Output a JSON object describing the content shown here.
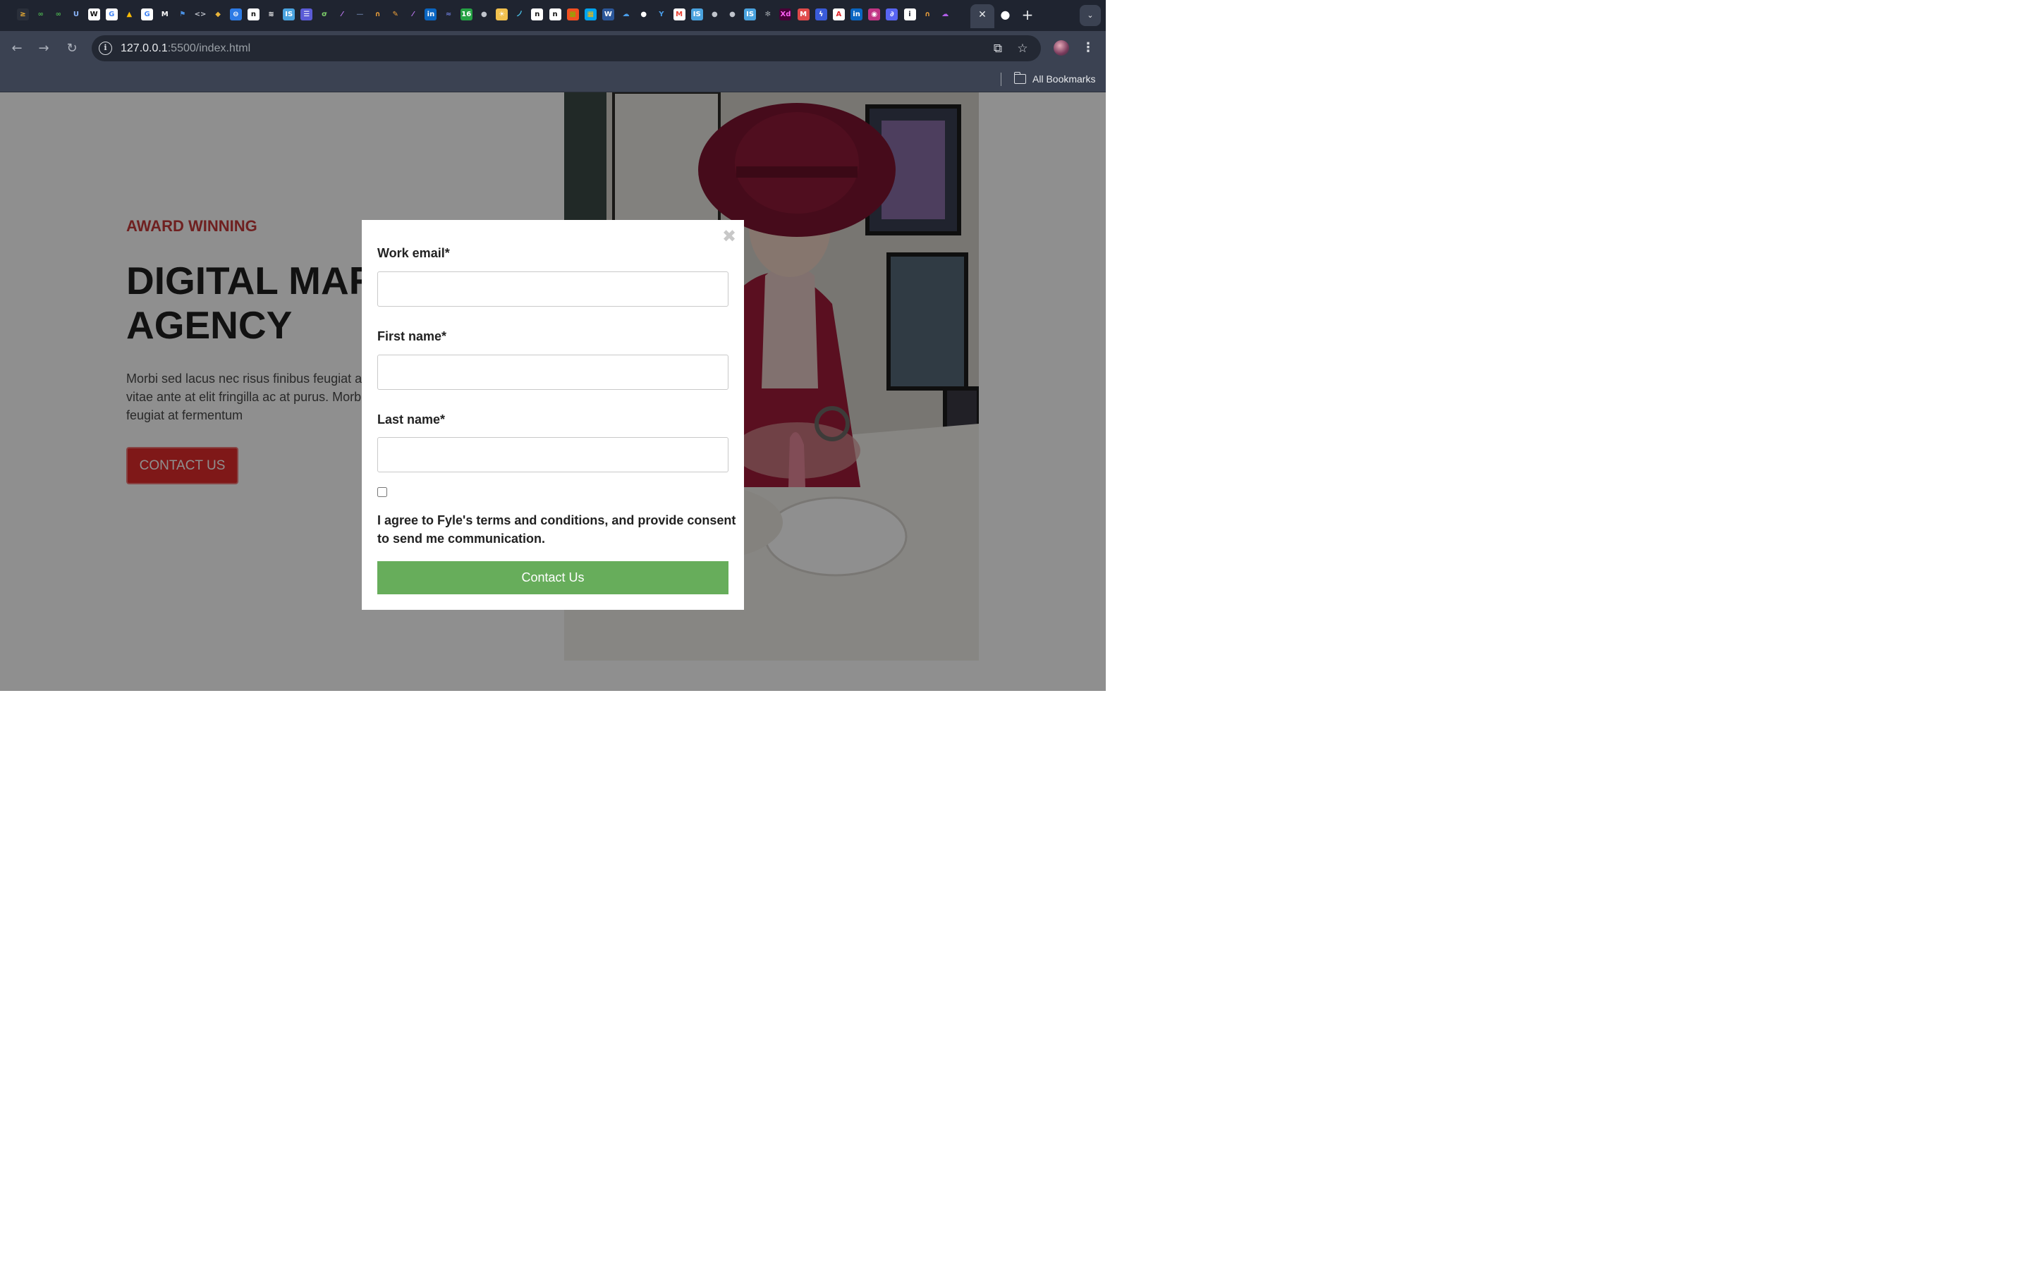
{
  "browser": {
    "tabs": {
      "favicons": [
        {
          "name": "stripe-favicon",
          "glyph": "≥",
          "bg": "#2a2f3a",
          "color": "#f2b233"
        },
        {
          "name": "link-favicon",
          "glyph": "∞",
          "bg": "#1f2430",
          "color": "#4caf50"
        },
        {
          "name": "link-favicon",
          "glyph": "∞",
          "bg": "#1f2430",
          "color": "#4caf50"
        },
        {
          "name": "bucket-favicon",
          "glyph": "U",
          "bg": "#1f2430",
          "color": "#8ab4f8"
        },
        {
          "name": "webflow-favicon",
          "glyph": "W",
          "bg": "#ffffff",
          "color": "#111111"
        },
        {
          "name": "google-favicon",
          "glyph": "G",
          "bg": "#ffffff",
          "color": "#4285f4"
        },
        {
          "name": "drive-favicon",
          "glyph": "▲",
          "bg": "#1f2430",
          "color": "#fbbc04"
        },
        {
          "name": "google-favicon",
          "glyph": "G",
          "bg": "#ffffff",
          "color": "#4285f4"
        },
        {
          "name": "medium-favicon",
          "glyph": "M",
          "bg": "#1f2430",
          "color": "#ffffff"
        },
        {
          "name": "flag-favicon",
          "glyph": "⚑",
          "bg": "#1f2430",
          "color": "#4a90e2"
        },
        {
          "name": "code-favicon",
          "glyph": "<>",
          "bg": "#1f2430",
          "color": "#c0c4cc"
        },
        {
          "name": "shield-favicon",
          "glyph": "◆",
          "bg": "#1f2430",
          "color": "#e8b43a"
        },
        {
          "name": "globe-favicon",
          "glyph": "⊖",
          "bg": "#2d7be5",
          "color": "#ffffff"
        },
        {
          "name": "notion-favicon",
          "glyph": "n",
          "bg": "#ffffff",
          "color": "#111111"
        },
        {
          "name": "stats-favicon",
          "glyph": "≋",
          "bg": "#1f2430",
          "color": "#ffffff"
        },
        {
          "name": "is-favicon",
          "glyph": "IS",
          "bg": "#4aa3df",
          "color": "#ffffff"
        },
        {
          "name": "list-favicon",
          "glyph": "☰",
          "bg": "#5b5bd6",
          "color": "#ffffff"
        },
        {
          "name": "leaf-favicon",
          "glyph": "σ",
          "bg": "#1f2430",
          "color": "#7fd36b"
        },
        {
          "name": "feather-favicon",
          "glyph": "⁄",
          "bg": "#1f2430",
          "color": "#c77dff"
        },
        {
          "name": "dash-favicon",
          "glyph": "—",
          "bg": "#1f2430",
          "color": "#5a6b8c"
        },
        {
          "name": "headset-favicon",
          "glyph": "∩",
          "bg": "#1f2430",
          "color": "#f2a33a"
        },
        {
          "name": "edit-favicon",
          "glyph": "✎",
          "bg": "#1f2430",
          "color": "#f2a33a"
        },
        {
          "name": "feather-favicon",
          "glyph": "⁄",
          "bg": "#1f2430",
          "color": "#c77dff"
        },
        {
          "name": "linkedin-favicon",
          "glyph": "in",
          "bg": "#0a66c2",
          "color": "#ffffff"
        },
        {
          "name": "wave-favicon",
          "glyph": "≈",
          "bg": "#1f2430",
          "color": "#6b7bd6"
        },
        {
          "name": "badge-favicon",
          "glyph": "16",
          "bg": "#25a244",
          "color": "#ffffff"
        },
        {
          "name": "globe-favicon",
          "glyph": "●",
          "bg": "#1f2430",
          "color": "#c0c4cc"
        },
        {
          "name": "sun-favicon",
          "glyph": "☀",
          "bg": "#f2c14e",
          "color": "#ffffff"
        },
        {
          "name": "pen-favicon",
          "glyph": "ノ",
          "bg": "#1f2430",
          "color": "#4ac1e8"
        },
        {
          "name": "notion-favicon",
          "glyph": "n",
          "bg": "#ffffff",
          "color": "#111111"
        },
        {
          "name": "notion-favicon",
          "glyph": "n",
          "bg": "#ffffff",
          "color": "#111111"
        },
        {
          "name": "microsoft-favicon",
          "glyph": "▦",
          "bg": "#f25022",
          "color": "#7fba00"
        },
        {
          "name": "microsoft-favicon",
          "glyph": "▦",
          "bg": "#00a4ef",
          "color": "#ffb900"
        },
        {
          "name": "word-favicon",
          "glyph": "W",
          "bg": "#2b579a",
          "color": "#ffffff"
        },
        {
          "name": "onedrive-favicon",
          "glyph": "☁",
          "bg": "#1f2430",
          "color": "#4a9de8"
        },
        {
          "name": "github-favicon",
          "glyph": "●",
          "bg": "#1f2430",
          "color": "#ffffff"
        },
        {
          "name": "bird-favicon",
          "glyph": "Y",
          "bg": "#1f2430",
          "color": "#4a9de8"
        },
        {
          "name": "gmail-favicon",
          "glyph": "M",
          "bg": "#ffffff",
          "color": "#ea4335"
        },
        {
          "name": "is-favicon",
          "glyph": "IS",
          "bg": "#4aa3df",
          "color": "#ffffff"
        },
        {
          "name": "globe-favicon",
          "glyph": "●",
          "bg": "#1f2430",
          "color": "#c0c4cc"
        },
        {
          "name": "globe-favicon",
          "glyph": "●",
          "bg": "#1f2430",
          "color": "#c0c4cc"
        },
        {
          "name": "is-favicon",
          "glyph": "IS",
          "bg": "#4aa3df",
          "color": "#ffffff"
        },
        {
          "name": "react-favicon",
          "glyph": "✻",
          "bg": "#1f2430",
          "color": "#9aa0a6"
        },
        {
          "name": "xd-favicon",
          "glyph": "Xd",
          "bg": "#470137",
          "color": "#ff61f6"
        },
        {
          "name": "mail-favicon",
          "glyph": "M",
          "bg": "#e04a4a",
          "color": "#ffffff"
        },
        {
          "name": "bolt-favicon",
          "glyph": "ϟ",
          "bg": "#3a5bd9",
          "color": "#ffffff"
        },
        {
          "name": "adobe-favicon",
          "glyph": "A",
          "bg": "#ffffff",
          "color": "#e0252a"
        },
        {
          "name": "linkedin-favicon",
          "glyph": "in",
          "bg": "#0a66c2",
          "color": "#ffffff"
        },
        {
          "name": "podcast-favicon",
          "glyph": "◉",
          "bg": "#c13584",
          "color": "#ffffff"
        },
        {
          "name": "drop-favicon",
          "glyph": "∂",
          "bg": "#5865f2",
          "color": "#ffffff"
        },
        {
          "name": "info-favicon",
          "glyph": "i",
          "bg": "#ffffff",
          "color": "#1f2430"
        },
        {
          "name": "headset-favicon",
          "glyph": "∩",
          "bg": "#1f2430",
          "color": "#f2a33a"
        },
        {
          "name": "cloud-favicon",
          "glyph": "☁",
          "bg": "#1f2430",
          "color": "#b15ee8"
        }
      ],
      "active_tab_close": "✕",
      "github_favicon": "●",
      "new_tab": "+",
      "tab_search": "⌄"
    },
    "toolbar": {
      "back": "←",
      "forward": "→",
      "reload": "↻",
      "site_info": "i",
      "url_host": "127.0.0.1",
      "url_path": ":5500/index.html",
      "cast_icon": "⧉",
      "bookmark_star": "☆",
      "menu": "⋮"
    },
    "bookmarks_bar": {
      "all_bookmarks": "All Bookmarks"
    }
  },
  "page": {
    "eyebrow": "AWARD WINNING",
    "headline_lines": [
      "DIGITAL MARKETING",
      "AGENCY"
    ],
    "body_lines": [
      "Morbi sed lacus nec risus finibus feugiat at",
      "vitae ante at elit fringilla ac at purus. Morbi",
      "feugiat at fermentum"
    ],
    "cta_label": "CONTACT US",
    "colors": {
      "eyebrow": "#c63a3a",
      "cta": "#e32b2b",
      "overlay": "rgba(0,0,0,0.44)"
    }
  },
  "modal": {
    "close": "✖",
    "fields": {
      "work_email": {
        "label": "Work email*",
        "value": "",
        "placeholder": ""
      },
      "first_name": {
        "label": "First name*",
        "value": "",
        "placeholder": ""
      },
      "last_name": {
        "label": "Last name*",
        "value": "",
        "placeholder": ""
      }
    },
    "consent": {
      "checked": false,
      "text_lines": [
        "I agree to Fyle's terms and conditions, and provide consent",
        "to send me communication."
      ]
    },
    "submit_label": "Contact Us",
    "colors": {
      "submit": "#67ad5b"
    }
  }
}
